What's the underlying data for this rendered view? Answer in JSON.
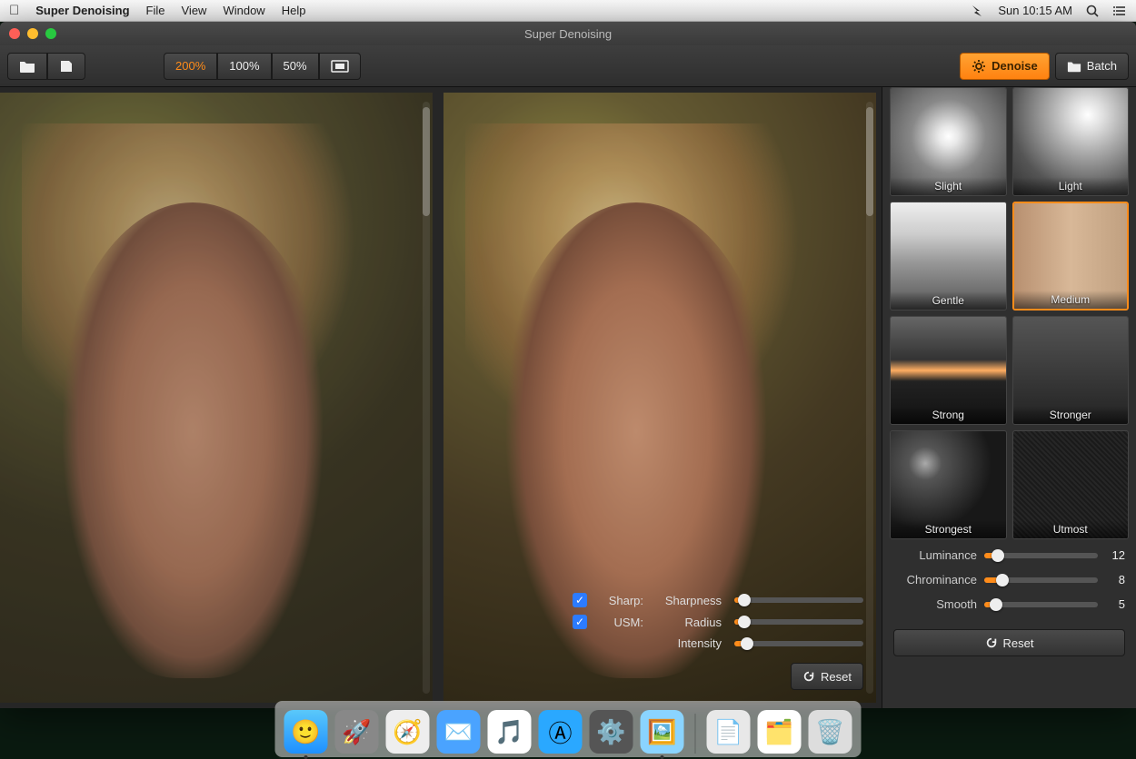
{
  "menubar": {
    "app_name": "Super Denoising",
    "items": [
      "File",
      "View",
      "Window",
      "Help"
    ],
    "clock": "Sun 10:15 AM"
  },
  "window": {
    "title": "Super Denoising"
  },
  "toolbar": {
    "zoom_levels": [
      "200%",
      "100%",
      "50%"
    ],
    "active_zoom_index": 0
  },
  "tabs": {
    "denoise": "Denoise",
    "batch": "Batch",
    "active": "denoise"
  },
  "presets": [
    {
      "id": "slight",
      "label": "Slight",
      "selected": false
    },
    {
      "id": "light",
      "label": "Light",
      "selected": false
    },
    {
      "id": "gentle",
      "label": "Gentle",
      "selected": false
    },
    {
      "id": "medium",
      "label": "Medium",
      "selected": true
    },
    {
      "id": "strong",
      "label": "Strong",
      "selected": false
    },
    {
      "id": "stronger",
      "label": "Stronger",
      "selected": false
    },
    {
      "id": "strongest",
      "label": "Strongest",
      "selected": false
    },
    {
      "id": "utmost",
      "label": "Utmost",
      "selected": false
    }
  ],
  "side_sliders": {
    "luminance": {
      "label": "Luminance",
      "value": 12,
      "max": 100
    },
    "chrominance": {
      "label": "Chrominance",
      "value": 8,
      "max": 100
    },
    "smooth": {
      "label": "Smooth",
      "value": 5,
      "max": 100
    }
  },
  "overlay": {
    "sharp_checked": true,
    "sharp_label": "Sharp:",
    "usm_checked": true,
    "usm_label": "USM:",
    "sharpness": {
      "label": "Sharpness",
      "value": 8,
      "max": 100
    },
    "radius": {
      "label": "Radius",
      "value": 8,
      "max": 100
    },
    "intensity": {
      "label": "Intensity",
      "value": 10,
      "max": 100
    }
  },
  "buttons": {
    "reset": "Reset"
  },
  "colors": {
    "accent": "#ff8c1a",
    "bg": "#2a2a2a"
  }
}
